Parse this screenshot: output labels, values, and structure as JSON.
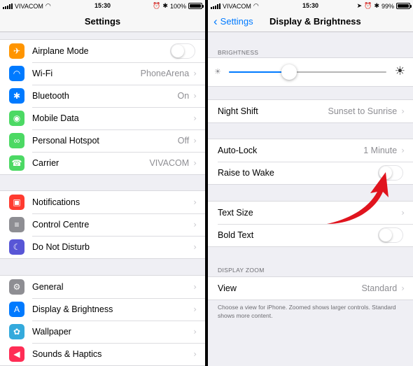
{
  "status": {
    "carrier": "VIVACOM",
    "left": {
      "time": "15:30",
      "battery": "100%",
      "battery_level": 1.0
    },
    "right": {
      "time": "15:30",
      "battery": "99%",
      "battery_level": 0.99
    }
  },
  "left_nav": {
    "title": "Settings"
  },
  "right_nav": {
    "back": "Settings",
    "title": "Display & Brightness"
  },
  "settings": {
    "group1": [
      {
        "label": "Airplane Mode",
        "icon": "airplane-icon",
        "color": "#ff9500",
        "control": "toggle",
        "on": false
      },
      {
        "label": "Wi-Fi",
        "value": "PhoneArena",
        "icon": "wifi-icon",
        "color": "#007aff"
      },
      {
        "label": "Bluetooth",
        "value": "On",
        "icon": "bluetooth-icon",
        "color": "#007aff"
      },
      {
        "label": "Mobile Data",
        "value": "",
        "icon": "antenna-icon",
        "color": "#4cd964"
      },
      {
        "label": "Personal Hotspot",
        "value": "Off",
        "icon": "hotspot-icon",
        "color": "#4cd964"
      },
      {
        "label": "Carrier",
        "value": "VIVACOM",
        "icon": "phone-icon",
        "color": "#4cd964"
      }
    ],
    "group2": [
      {
        "label": "Notifications",
        "icon": "notifications-icon",
        "color": "#ff3b30"
      },
      {
        "label": "Control Centre",
        "icon": "control-centre-icon",
        "color": "#8e8e93"
      },
      {
        "label": "Do Not Disturb",
        "icon": "moon-icon",
        "color": "#5856d6"
      }
    ],
    "group3": [
      {
        "label": "General",
        "icon": "gear-icon",
        "color": "#8e8e93"
      },
      {
        "label": "Display & Brightness",
        "icon": "text-size-icon",
        "color": "#007aff"
      },
      {
        "label": "Wallpaper",
        "icon": "flower-icon",
        "color": "#34aadc"
      },
      {
        "label": "Sounds & Haptics",
        "icon": "speaker-icon",
        "color": "#ff2d55"
      }
    ]
  },
  "display": {
    "brightness_header": "BRIGHTNESS",
    "brightness_level": 0.38,
    "night_shift": {
      "label": "Night Shift",
      "value": "Sunset to Sunrise"
    },
    "auto_lock": {
      "label": "Auto-Lock",
      "value": "1 Minute"
    },
    "raise_to_wake": {
      "label": "Raise to Wake",
      "on": false
    },
    "text_size": {
      "label": "Text Size"
    },
    "bold_text": {
      "label": "Bold Text",
      "on": false
    },
    "zoom_header": "DISPLAY ZOOM",
    "view": {
      "label": "View",
      "value": "Standard"
    },
    "footnote": "Choose a view for iPhone. Zoomed shows larger controls. Standard shows more content."
  },
  "annotation": {
    "arrow_color": "#e0141e"
  }
}
